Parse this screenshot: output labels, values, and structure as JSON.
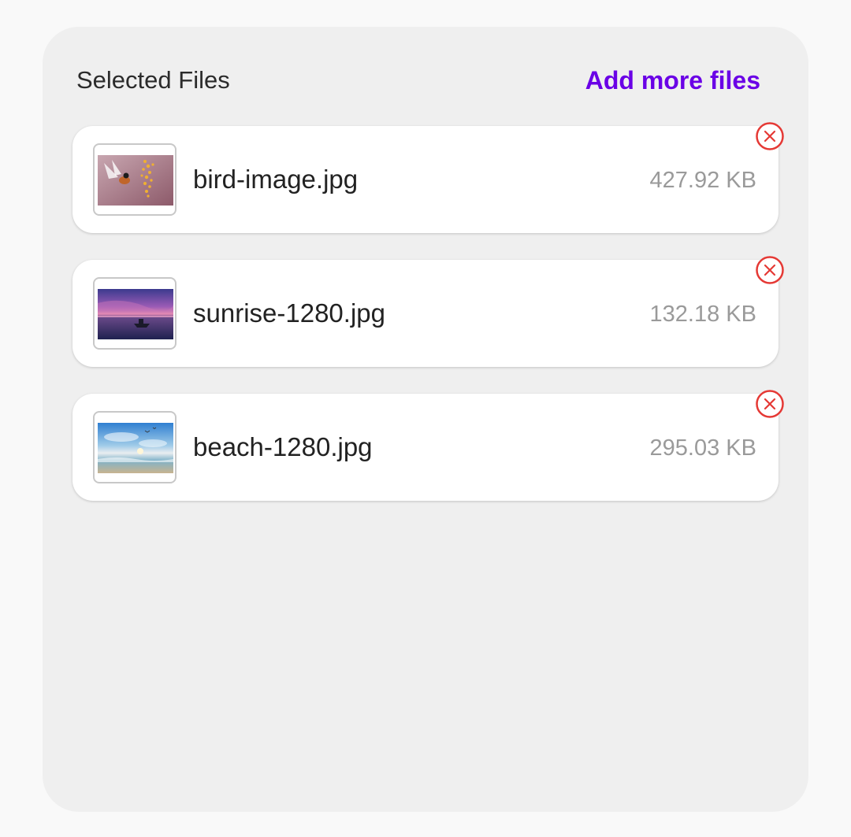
{
  "header": {
    "title": "Selected Files",
    "add_more_label": "Add more files"
  },
  "colors": {
    "accent": "#6a00e6",
    "remove": "#e53935"
  },
  "files": [
    {
      "name": "bird-image.jpg",
      "size": "427.92 KB",
      "thumbnail": "bird-image"
    },
    {
      "name": "sunrise-1280.jpg",
      "size": "132.18 KB",
      "thumbnail": "sunrise-image"
    },
    {
      "name": "beach-1280.jpg",
      "size": "295.03 KB",
      "thumbnail": "beach-image"
    }
  ],
  "icons": {
    "remove": "close-circle-icon"
  }
}
